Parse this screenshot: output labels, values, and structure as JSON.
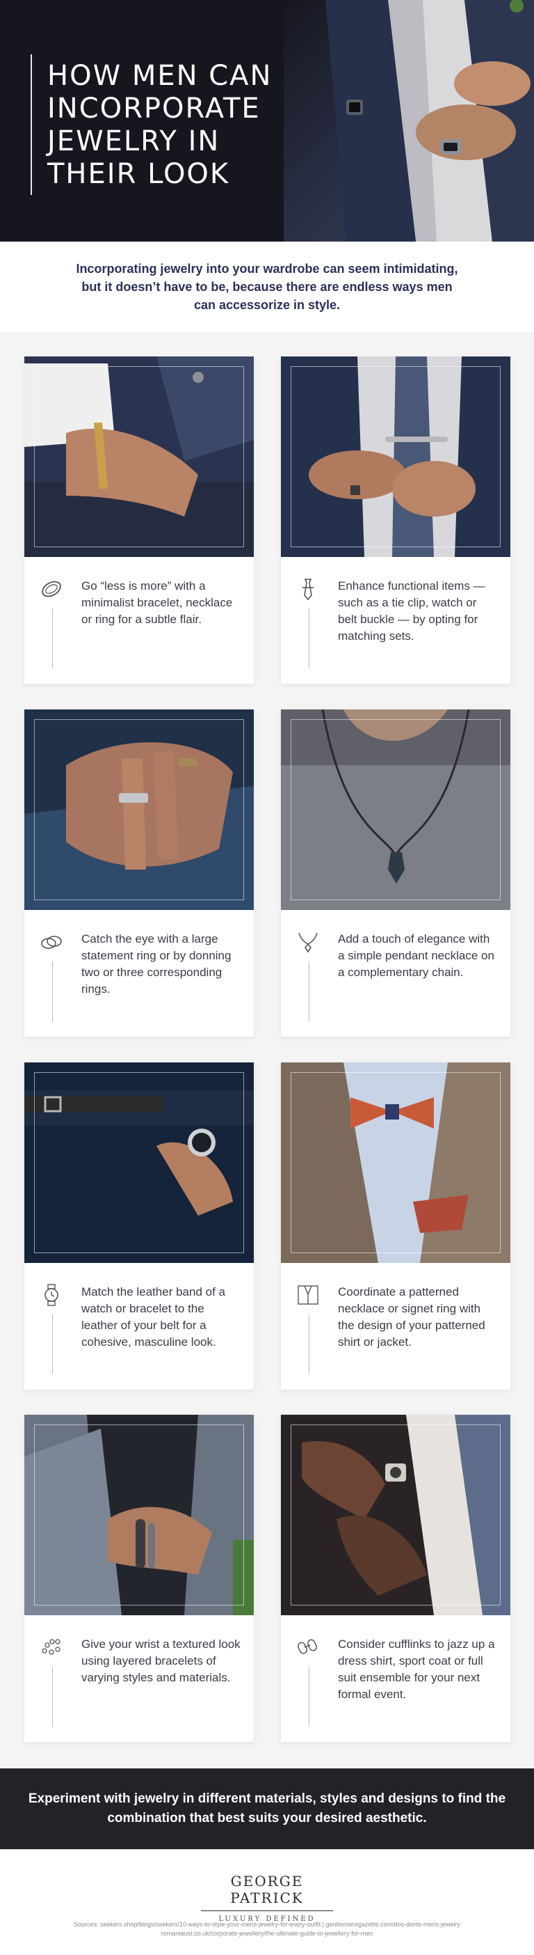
{
  "hero": {
    "title": "HOW MEN CAN INCORPORATE JEWELRY IN THEIR LOOK"
  },
  "intro": {
    "text": "Incorporating jewelry into your wardrobe can seem intimidating, but it doesn’t have to be, because there are endless ways men can accessorize in style."
  },
  "cards": [
    {
      "icon": "bracelet-icon",
      "text": "Go “less is more” with a minimalist bracelet, necklace or ring for a subtle flair."
    },
    {
      "icon": "tie-clip-icon",
      "text": "Enhance functional items — such as a tie clip, watch or belt buckle — by opting for matching sets."
    },
    {
      "icon": "rings-icon",
      "text": "Catch the eye with a large statement ring or by donning two or three corresponding rings."
    },
    {
      "icon": "pendant-necklace-icon",
      "text": "Add a touch of elegance with a simple pendant necklace on a complementary chain."
    },
    {
      "icon": "watch-icon",
      "text": "Match the leather band of a watch or bracelet to the leather of your belt for a cohesive, masculine look."
    },
    {
      "icon": "jacket-icon",
      "text": "Coordinate a patterned necklace or signet ring with the design of your patterned shirt or jacket."
    },
    {
      "icon": "beaded-bracelet-icon",
      "text": "Give your wrist a textured look using layered bracelets of varying styles and materials."
    },
    {
      "icon": "cufflinks-icon",
      "text": "Consider cufflinks to jazz up a dress shirt, sport coat or full suit ensemble for your next formal event."
    }
  ],
  "banner": {
    "text": "Experiment with jewelry in different materials, styles and designs to find the combination that best suits your desired aesthetic."
  },
  "brand": {
    "name": "GEORGE PATRICK",
    "tagline": "LUXURY DEFINED",
    "sources": "Sources: seekers.shop/blogs/seekers/10-ways-to-style-your-mens-jewelry-for-every-outfit | gentlemansgazette.com/dos-donts-mens-jewelry romantaust.co.uk/corporate-jewellery/the-ultimate-guide-to-jewellery-for-men"
  },
  "colors": {
    "hero_bg": "#16161f",
    "intro_text": "#2b3058",
    "banner_bg": "#222228",
    "page_bg": "#f4f4f4"
  }
}
